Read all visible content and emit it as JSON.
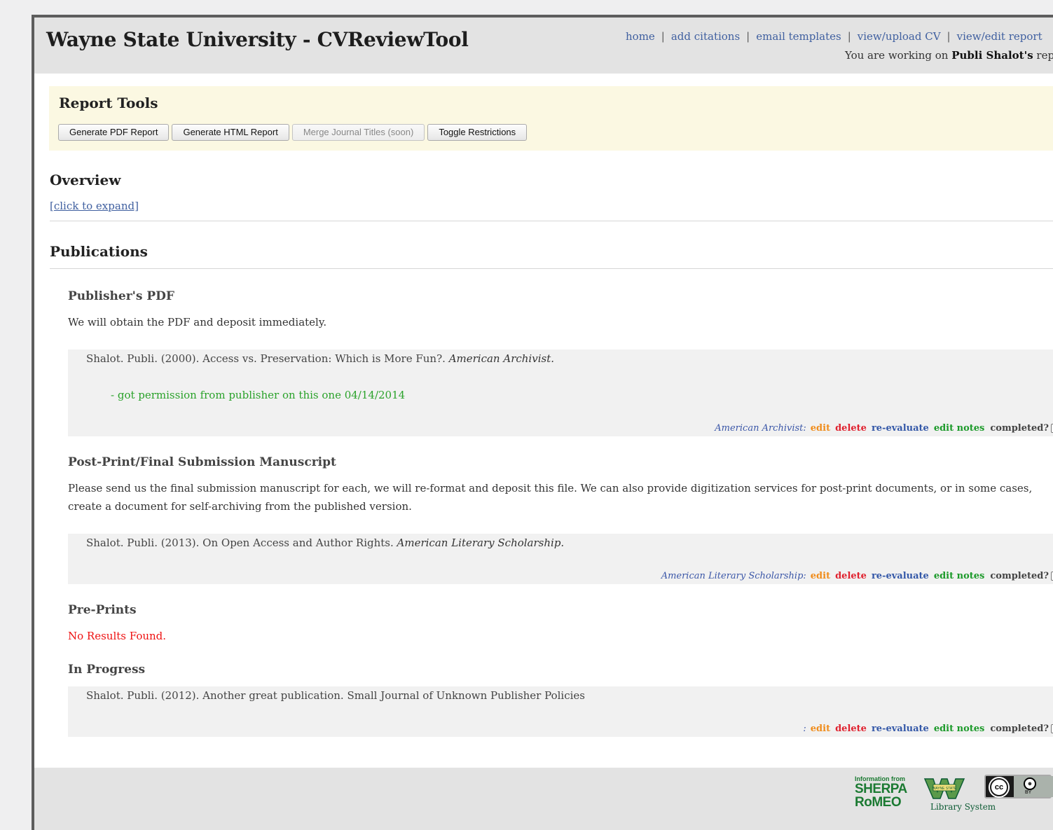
{
  "header": {
    "title": "Wayne State University - CVReviewTool",
    "nav": [
      "home",
      "add citations",
      "email templates",
      "view/upload CV",
      "view/edit report"
    ],
    "nav_separator": "|",
    "working_prefix": "You are working on ",
    "working_name": "Publi Shalot's",
    "working_suffix": " report"
  },
  "report_tools": {
    "title": "Report Tools",
    "buttons": {
      "pdf": "Generate PDF Report",
      "html": "Generate HTML Report",
      "merge": "Merge Journal Titles (soon)",
      "toggle": "Toggle Restrictions"
    }
  },
  "overview": {
    "title": "Overview",
    "expand_link": "[click to expand]"
  },
  "publications": {
    "title": "Publications",
    "publishers_pdf": {
      "title": "Publisher's PDF",
      "description": "We will obtain the PDF and deposit immediately.",
      "citation_text": "Shalot. Publi. (2000). Access vs. Preservation: Which is More Fun?. ",
      "citation_journal": "American Archivist.",
      "note": "- got permission from publisher on this one 04/14/2014",
      "journal_label": "American Archivist:"
    },
    "postprint": {
      "title": "Post-Print/Final Submission Manuscript",
      "description": "Please send us the final submission manuscript for each, we will re-format and deposit this file. We can also provide digitization services for post-print documents, or in some cases, create a document for self-archiving from the published version.",
      "citation_text": "Shalot. Publi. (2013). On Open Access and Author Rights. ",
      "citation_journal": "American Literary Scholarship.",
      "journal_label": "American Literary Scholarship:"
    },
    "preprints": {
      "title": "Pre-Prints",
      "no_results": "No Results Found."
    },
    "in_progress": {
      "title": "In Progress",
      "citation_text": "Shalot. Publi. (2012). Another great publication. Small Journal of Unknown Publisher Policies",
      "journal_label": ":"
    }
  },
  "actions": {
    "edit": "edit",
    "delete": "delete",
    "reevaluate": "re-evaluate",
    "edit_notes": "edit notes",
    "completed": "completed?"
  },
  "footer": {
    "sherpa_small": "Information from",
    "sherpa_line1": "SHERPA",
    "sherpa_line2": "RoMEO",
    "wsu_text": "Library System",
    "wsu_shield": "WAYNE STATE",
    "cc_text": "cc",
    "by_text": "BY"
  },
  "colors": {
    "link": "#4060a0",
    "tools_bg": "#fbf8e2",
    "note_green": "#2aa22a",
    "error_red": "#e11111",
    "action_edit": "#f08d1c",
    "action_delete": "#e0222f",
    "action_reevaluate": "#3458a8",
    "action_notes": "#1c9a2a"
  }
}
